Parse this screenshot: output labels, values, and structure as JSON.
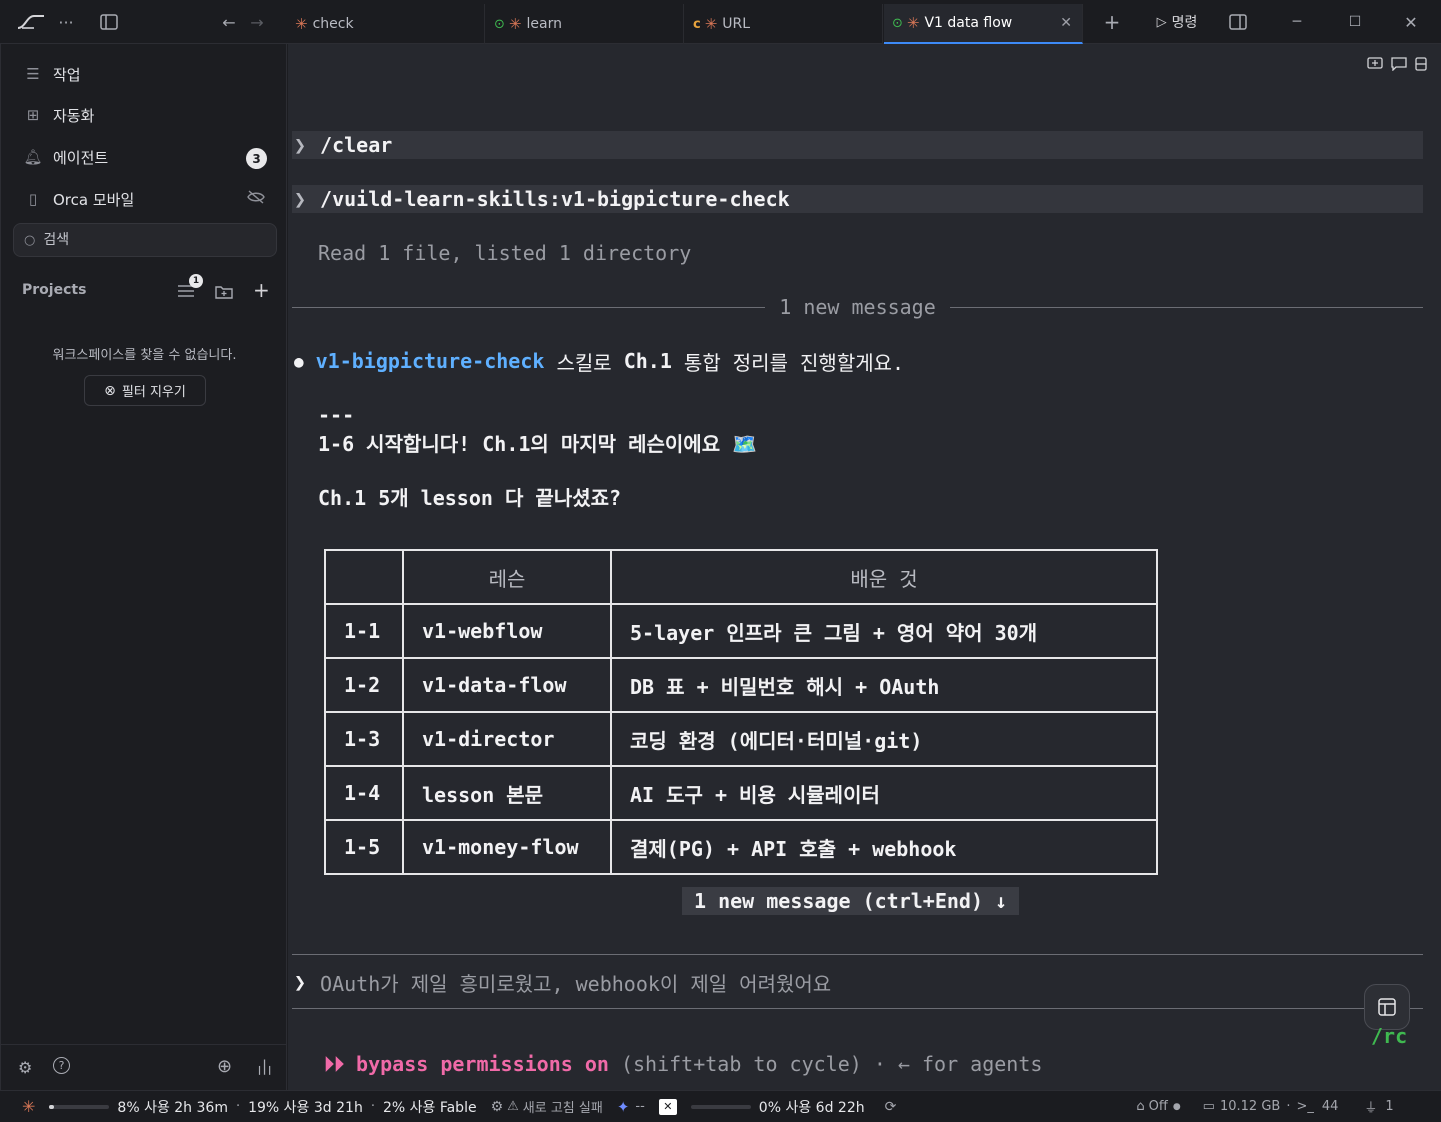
{
  "titlebar": {
    "tabs": [
      {
        "label": "check",
        "status": "none"
      },
      {
        "label": "learn",
        "status": "ok"
      },
      {
        "label": "URL",
        "status": "loading"
      },
      {
        "label": "V1 data flow",
        "status": "ok",
        "active": true
      }
    ],
    "command_label": "명령"
  },
  "sidebar": {
    "items": [
      {
        "label": "작업",
        "icon": "list-icon"
      },
      {
        "label": "자동화",
        "icon": "calendar-clock-icon"
      },
      {
        "label": "에이전트",
        "icon": "bell-icon",
        "badge": "3"
      },
      {
        "label": "Orca 모바일",
        "icon": "phone-icon"
      }
    ],
    "search_placeholder": "검색",
    "projects_label": "Projects",
    "filter_badge": "1",
    "empty_message": "워크스페이스를 찾을 수 없습니다.",
    "clear_filter_label": "필터 지우기"
  },
  "terminal": {
    "cmd1": "/clear",
    "cmd2": "/vuild-learn-skills:v1-bigpicture-check",
    "read_line": "Read 1 file, listed 1 directory",
    "new_message_divider": "1 new message",
    "bullet_skill": "v1-bigpicture-check",
    "bullet_mid": " 스킬로 ",
    "bullet_ch": "Ch.1",
    "bullet_rest": " 통합 정리를 진행할게요.",
    "hr": "---",
    "heading": "1-6 시작합니다! Ch.1의 마지막 레슨이에요 🗺️",
    "question": "Ch.1 5개 lesson 다 끝나셨죠?",
    "table": {
      "headers": [
        "",
        "레슨",
        "배운 것"
      ],
      "rows": [
        [
          "1-1",
          "v1-webflow",
          "5-layer 인프라 큰 그림 + 영어 약어 30개"
        ],
        [
          "1-2",
          "v1-data-flow",
          "DB 표 + 비밀번호 해시 + OAuth"
        ],
        [
          "1-3",
          "v1-director",
          "코딩 환경 (에디터·터미널·git)"
        ],
        [
          "1-4",
          "lesson 본문",
          "AI 도구 + 비용 시뮬레이터"
        ],
        [
          "1-5",
          "v1-money-flow",
          "결제(PG) + API 호출 + webhook"
        ]
      ]
    },
    "jump_hint": "1 new message (ctrl+End) ↓",
    "input_text": "OAuth가 제일 흥미로웠고, webhook이 제일 어려웠어요",
    "mode_arrows": "⏵⏵ ",
    "mode_label": "bypass permissions on",
    "mode_hint": " (shift+tab to cycle) · ← for agents",
    "rc_label": "/rc"
  },
  "statusbar": {
    "usage1": "8% 사용 2h 36m",
    "usage1_level": 0.08,
    "usage2": "19% 사용 3d 21h",
    "usage3": "2% 사용 Fable",
    "refresh_failed": "새로 고침 실패",
    "gemini_value": "--",
    "usage4": "0% 사용 6d 22h",
    "usage4_level": 0.0,
    "power_label": "Off",
    "memory": "10.12 GB",
    "terminals": "44",
    "plugs": "1"
  },
  "colors": {
    "accent": "#3d8af7",
    "claude": "#d97757",
    "skill": "#5fb0ff",
    "mode": "#f06aa8"
  }
}
